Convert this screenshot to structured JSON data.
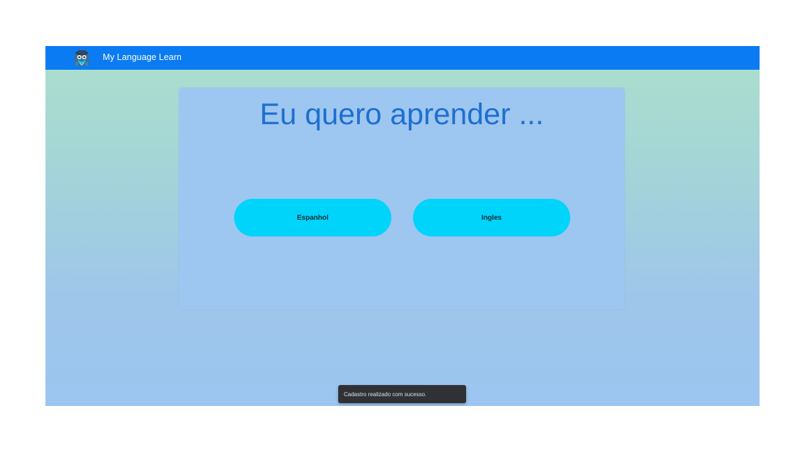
{
  "navbar": {
    "app_title": "My Language Learn",
    "logo_icon": "cartoon-mascot-logo-icon",
    "background_color": "#0a7bf3"
  },
  "main": {
    "heading": "Eu quero aprender ...",
    "heading_color": "#1e6fcf",
    "languages": [
      {
        "label": "Espanhol"
      },
      {
        "label": "Ingles"
      }
    ],
    "button_color": "#00d4fb"
  },
  "toast": {
    "message": "Cadastro realizado com sucesso."
  }
}
